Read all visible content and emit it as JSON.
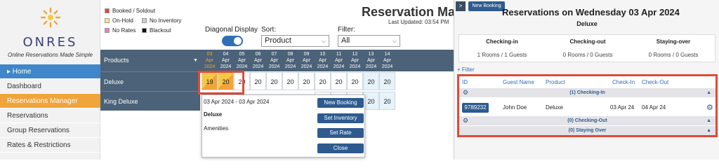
{
  "sidebar": {
    "brand": "ONRES",
    "tagline": "Online Reservations Made Simple",
    "items": [
      {
        "label": "▸ Home",
        "state": "home"
      },
      {
        "label": "Dashboard",
        "state": ""
      },
      {
        "label": "Reservations Manager",
        "state": "active"
      },
      {
        "label": "Reservations",
        "state": ""
      },
      {
        "label": "Group Reservations",
        "state": ""
      },
      {
        "label": "Rates & Restrictions",
        "state": ""
      }
    ]
  },
  "legend": [
    {
      "label": "Booked / Soldout",
      "color": "#e04a37"
    },
    {
      "label": "On-Hold",
      "color": "#f7e98a"
    },
    {
      "label": "No Inventory",
      "color": "#cccccc"
    },
    {
      "label": "No Rates",
      "color": "#e882b8"
    },
    {
      "label": "Blackout",
      "color": "#111111"
    }
  ],
  "controls": {
    "diagonal_label": "Diagonal Display",
    "sort_label": "Sort:",
    "sort_value": "Product",
    "filter_label": "Filter:",
    "filter_value": "All"
  },
  "header": {
    "title": "Reservation Man",
    "updated": "Last Updated: 03:54 PM"
  },
  "grid": {
    "products_header": "Products",
    "dates": [
      {
        "day": "03",
        "mon": "Apr",
        "yr": "2024",
        "today": true
      },
      {
        "day": "04",
        "mon": "Apr",
        "yr": "2024",
        "today": false
      },
      {
        "day": "05",
        "mon": "Apr",
        "yr": "2024",
        "today": false
      },
      {
        "day": "06",
        "mon": "Apr",
        "yr": "2024",
        "today": false
      },
      {
        "day": "07",
        "mon": "Apr",
        "yr": "2024",
        "today": false
      },
      {
        "day": "08",
        "mon": "Apr",
        "yr": "2024",
        "today": false
      },
      {
        "day": "09",
        "mon": "Apr",
        "yr": "2024",
        "today": false
      },
      {
        "day": "10",
        "mon": "Apr",
        "yr": "2024",
        "today": false
      },
      {
        "day": "11",
        "mon": "Apr",
        "yr": "2024",
        "today": false
      },
      {
        "day": "12",
        "mon": "Apr",
        "yr": "2024",
        "today": false
      },
      {
        "day": "13",
        "mon": "Apr",
        "yr": "2024",
        "today": false
      },
      {
        "day": "14",
        "mon": "Apr",
        "yr": "2024",
        "today": false
      }
    ],
    "rows": [
      {
        "name": "Deluxe",
        "cells": [
          "19",
          "20",
          "20",
          "20",
          "20",
          "20",
          "20",
          "20",
          "20",
          "20",
          "20",
          "20"
        ]
      },
      {
        "name": "King Deluxe",
        "cells": [
          "",
          "",
          "",
          "",
          "",
          "",
          "",
          "20",
          "20",
          "20",
          "20",
          "20"
        ]
      }
    ]
  },
  "popup": {
    "dates": "03 Apr 2024 - 03 Apr 2024",
    "room": "Deluxe",
    "amenities": "Amenities",
    "buttons": [
      "New Booking",
      "Set Inventory",
      "Set Rate",
      "Close"
    ]
  },
  "panel": {
    "collapse": ">",
    "new_booking": "New Booking",
    "title": "Reservations on Wednesday 03 Apr 2024",
    "subtitle": "Deluxe",
    "stats": [
      {
        "label": "Checking-in",
        "value": "1 Rooms / 1 Guests"
      },
      {
        "label": "Checking-out",
        "value": "0 Rooms / 0 Guests"
      },
      {
        "label": "Staying-over",
        "value": "0 Rooms / 0 Guests"
      }
    ],
    "filter_link": "+ Filter",
    "columns": [
      "ID",
      "Guest Name",
      "Product",
      "Check-In",
      "Check-Out"
    ],
    "groups": [
      "(1) Checking-In",
      "(0) Checking-Out",
      "(0) Staying Over"
    ],
    "booking": {
      "id": "9789232",
      "guest": "John Doe",
      "product": "Deluxe",
      "check_in": "03 Apr 24",
      "check_out": "04 Apr 24"
    }
  }
}
